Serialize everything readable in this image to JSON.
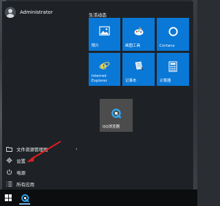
{
  "user": {
    "name": "Administrator"
  },
  "left_menu": [
    {
      "label": "文件资源管理器",
      "icon": "folder-icon",
      "has_chevron": true
    },
    {
      "label": "设置",
      "icon": "gear-icon",
      "has_chevron": false
    },
    {
      "label": "电源",
      "icon": "power-icon",
      "has_chevron": false
    },
    {
      "label": "所有应用",
      "icon": "list-icon",
      "has_chevron": false
    }
  ],
  "tiles_group": {
    "title": "生活动态"
  },
  "tiles": {
    "photos": {
      "label": "照片",
      "icon": "photo-icon"
    },
    "paint": {
      "label": "画图工具",
      "icon": "paint-icon"
    },
    "cortana": {
      "label": "Cortana",
      "icon": "cortana-icon"
    },
    "ie": {
      "label": "Internet\nExplorer",
      "icon": "ie-icon"
    },
    "notepad": {
      "label": "记事本",
      "icon": "notepad-icon"
    },
    "calculator": {
      "label": "计算器",
      "icon": "calculator-icon"
    },
    "qqbrowser": {
      "label": "QQ浏览器",
      "icon": "qq-browser-icon"
    }
  },
  "colors": {
    "tile_blue": "#0a78d7",
    "tile_gray": "#4c4c4c",
    "menu_bg": "#1e2226",
    "taskbar_bg": "#0b0d0f",
    "annotation_arrow": "#e02020"
  }
}
